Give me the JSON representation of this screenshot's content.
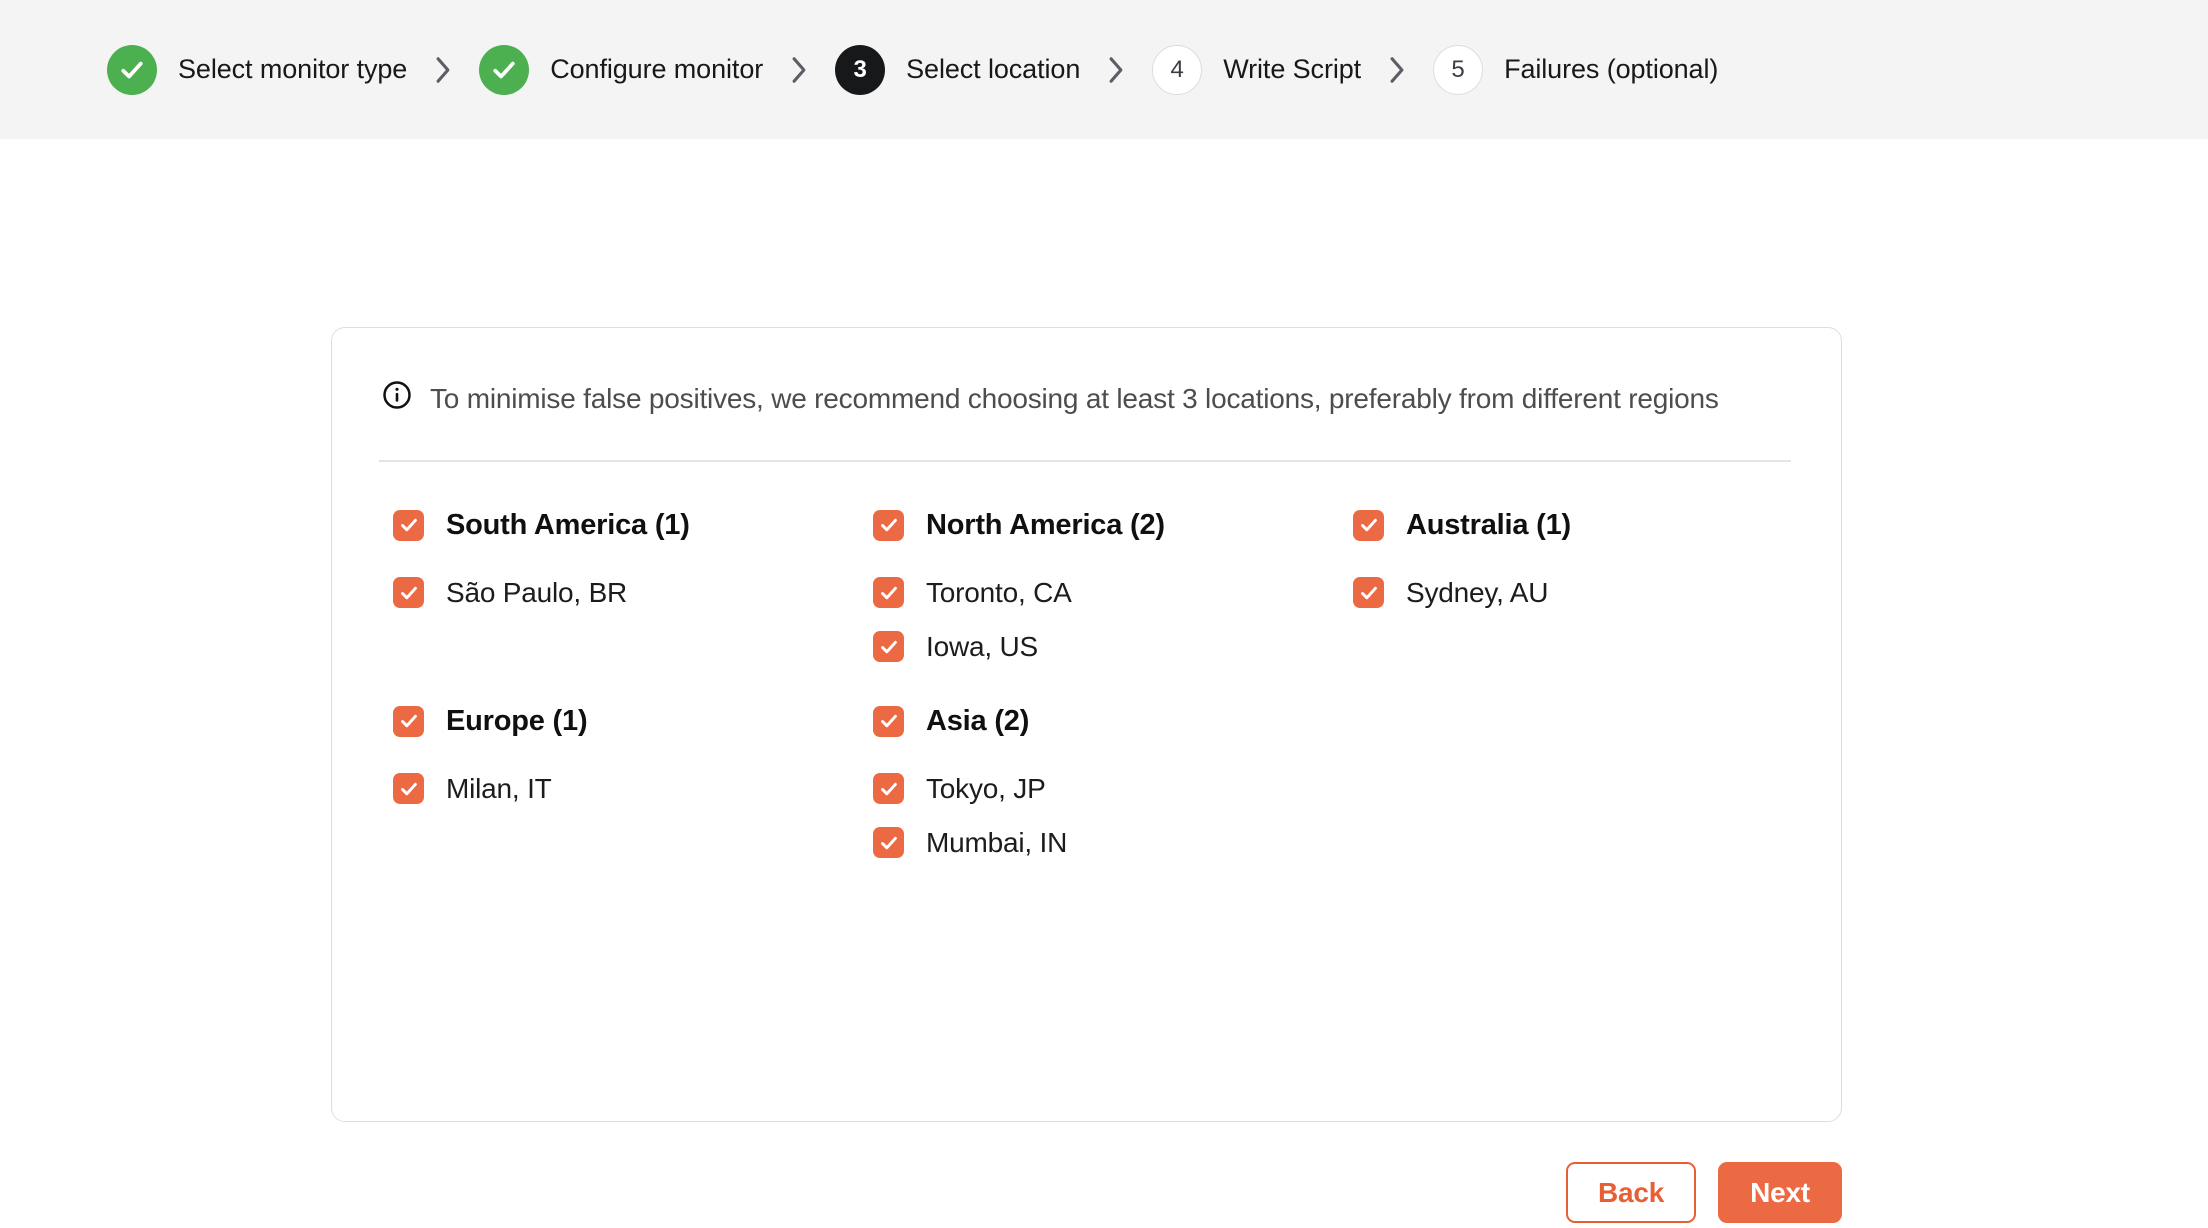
{
  "theme": {
    "accent": "#ec6a43",
    "accent_border": "#e85f33",
    "success": "#4caf50",
    "current_step_bg": "#17181a",
    "header_bg": "#f4f4f4",
    "card_border": "#dedede"
  },
  "stepper": {
    "steps": [
      {
        "number": "1",
        "label": "Select monitor type",
        "state": "done",
        "icon": "check-icon"
      },
      {
        "number": "2",
        "label": "Configure monitor",
        "state": "done",
        "icon": "check-icon"
      },
      {
        "number": "3",
        "label": "Select location",
        "state": "current",
        "icon": ""
      },
      {
        "number": "4",
        "label": "Write Script",
        "state": "pending",
        "icon": ""
      },
      {
        "number": "5",
        "label": "Failures (optional)",
        "state": "pending",
        "icon": ""
      }
    ],
    "separator_icon": "chevron-right-icon"
  },
  "notice": {
    "icon": "info-circle-icon",
    "text": "To minimise false positives, we recommend choosing at least 3 locations, preferably from different regions"
  },
  "regions": [
    {
      "name": "South America (1)",
      "checked": true,
      "cities": [
        {
          "name": "São Paulo, BR",
          "checked": true
        }
      ]
    },
    {
      "name": "North America (2)",
      "checked": true,
      "cities": [
        {
          "name": "Toronto, CA",
          "checked": true
        },
        {
          "name": "Iowa, US",
          "checked": true
        }
      ]
    },
    {
      "name": "Australia (1)",
      "checked": true,
      "cities": [
        {
          "name": "Sydney, AU",
          "checked": true
        }
      ]
    },
    {
      "name": "Europe (1)",
      "checked": true,
      "cities": [
        {
          "name": "Milan, IT",
          "checked": true
        }
      ]
    },
    {
      "name": "Asia (2)",
      "checked": true,
      "cities": [
        {
          "name": "Tokyo, JP",
          "checked": true
        },
        {
          "name": "Mumbai, IN",
          "checked": true
        }
      ]
    }
  ],
  "actions": {
    "back_label": "Back",
    "next_label": "Next"
  }
}
